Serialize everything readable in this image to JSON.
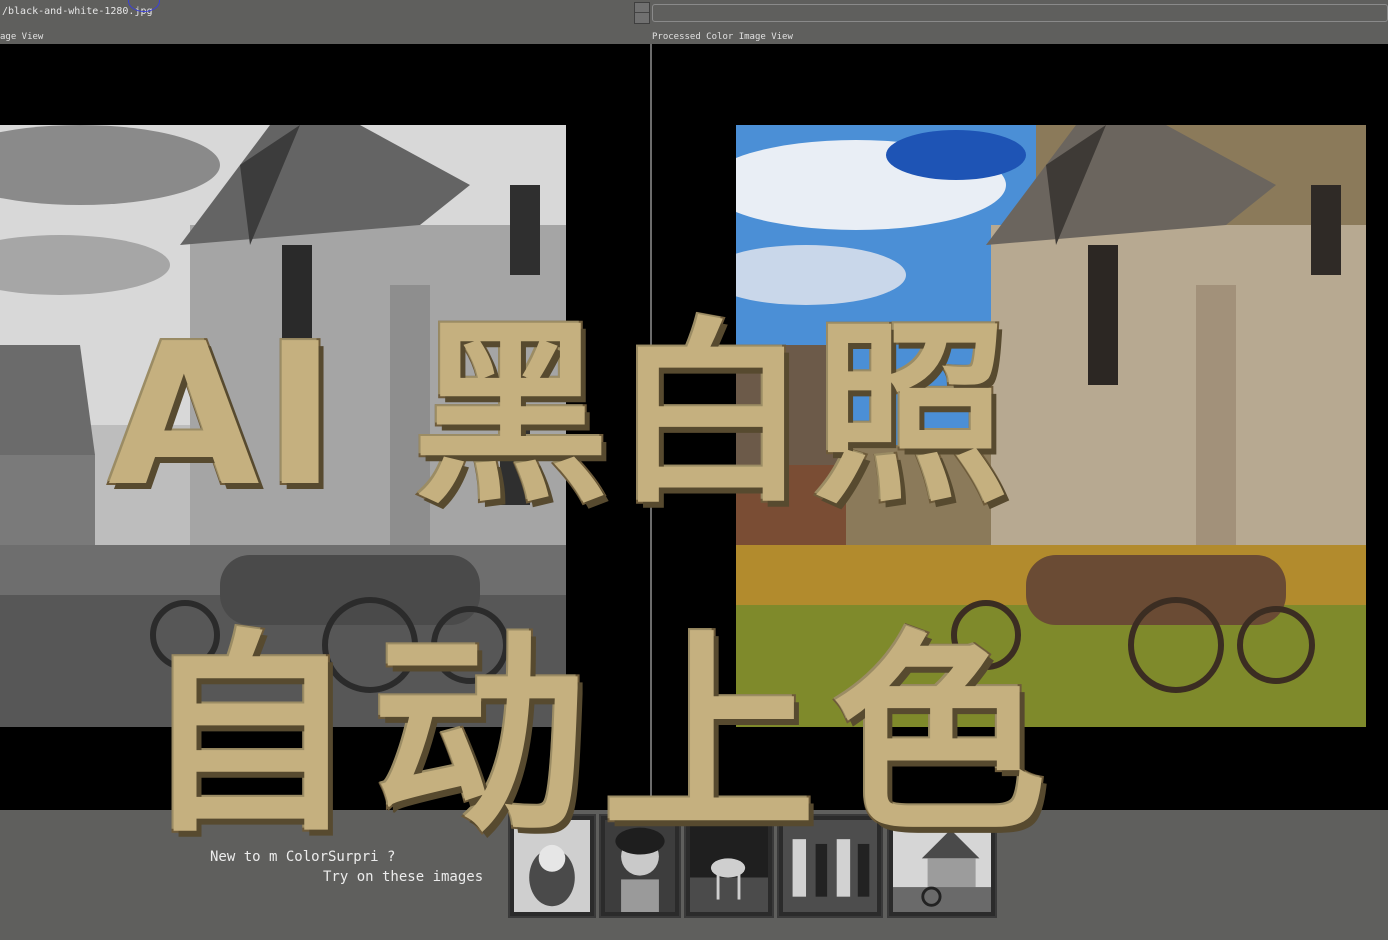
{
  "toolbar": {
    "file_path": "/black-and-white-1280.jpg",
    "search_value": ""
  },
  "panels": {
    "left_label": "age View",
    "right_label": "Processed Color Image View"
  },
  "overlay": {
    "line1": "AI 黑白照",
    "line2": "自动上色"
  },
  "bottom": {
    "prompt_line1": "New to    m ColorSurpri    ?",
    "prompt_line2": "Try on these images"
  },
  "thumbnails": [
    "sample-portrait-1",
    "sample-girl-portrait",
    "sample-deer",
    "sample-group-photo",
    "sample-house-wagon"
  ],
  "colors": {
    "background": "#5f5f5d",
    "view": "#000000",
    "overlay_fill": "#c5b07f",
    "overlay_stroke": "#6e5b3a"
  },
  "icons": {
    "stepper": "up-down-stepper-icon"
  }
}
